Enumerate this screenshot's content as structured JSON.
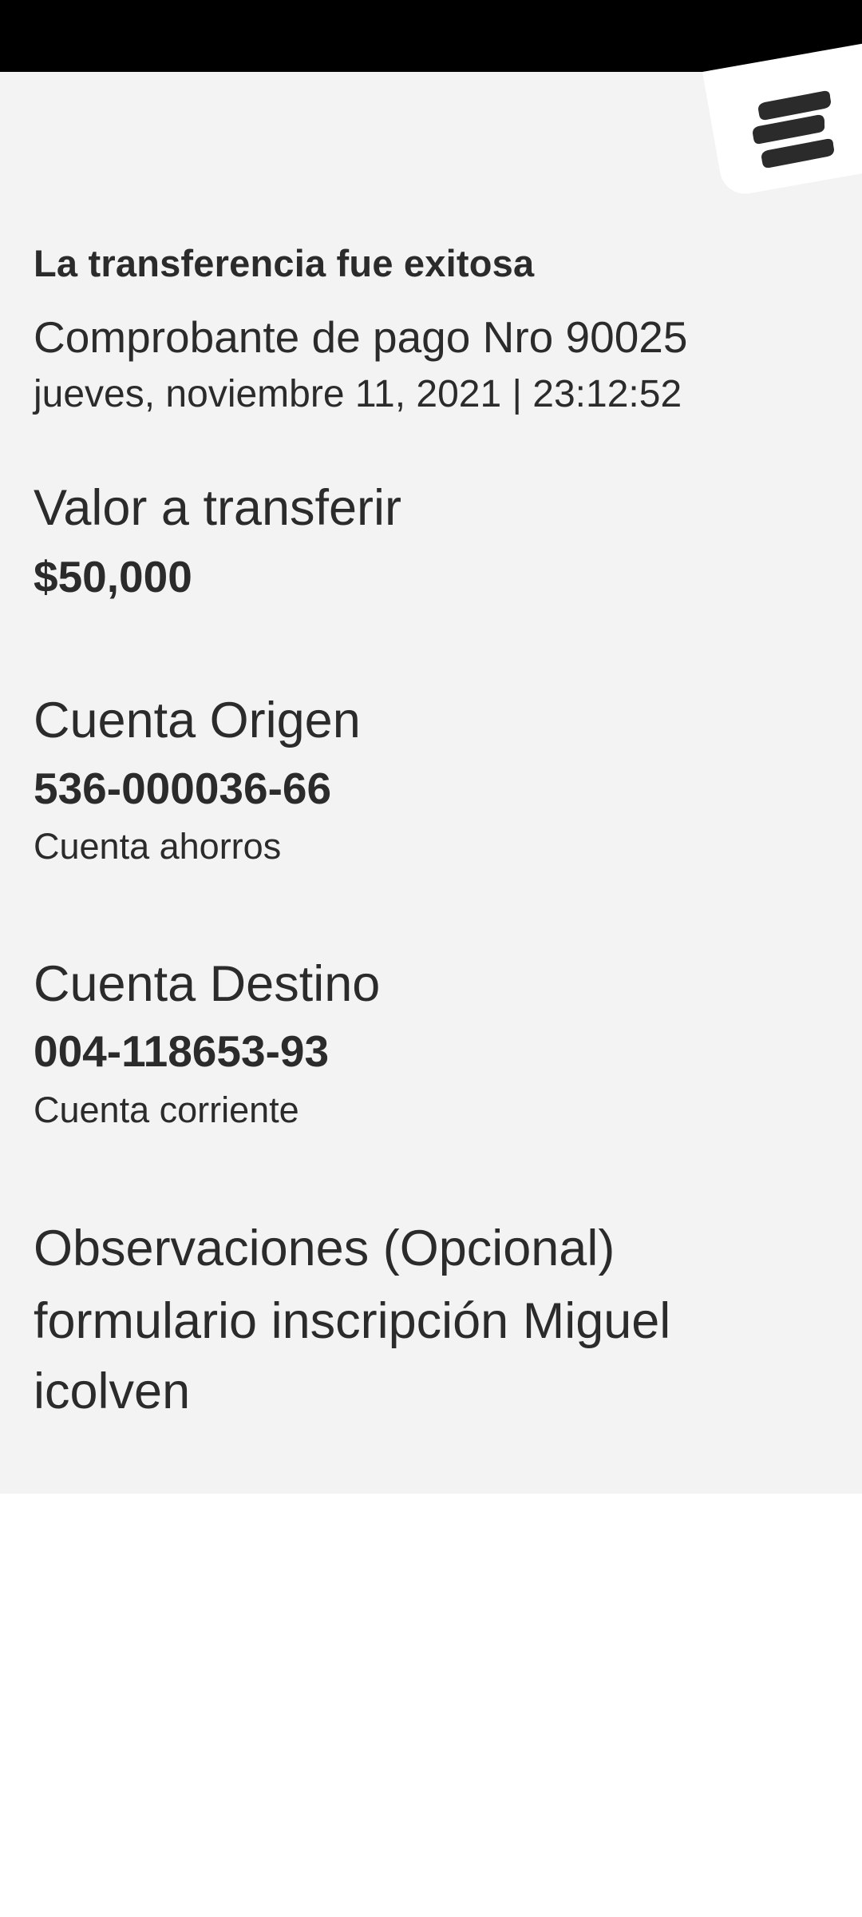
{
  "receipt": {
    "success_title": "La transferencia fue exitosa",
    "receipt_number": "Comprobante de pago Nro  90025",
    "datetime": "jueves, noviembre 11, 2021 | 23:12:52"
  },
  "amount": {
    "label": "Valor a transferir",
    "value": "$50,000"
  },
  "origin": {
    "label": "Cuenta Origen",
    "number": "536-000036-66",
    "type": "Cuenta ahorros"
  },
  "destination": {
    "label": "Cuenta Destino",
    "number": "004-118653-93",
    "type": "Cuenta corriente"
  },
  "observations": {
    "label": "Observaciones (Opcional)",
    "text": "formulario inscripción Miguel icolven"
  },
  "brand": {
    "icon": "bank-logo-icon",
    "background": "#f3f3f3",
    "text_color": "#2b2b2b"
  }
}
